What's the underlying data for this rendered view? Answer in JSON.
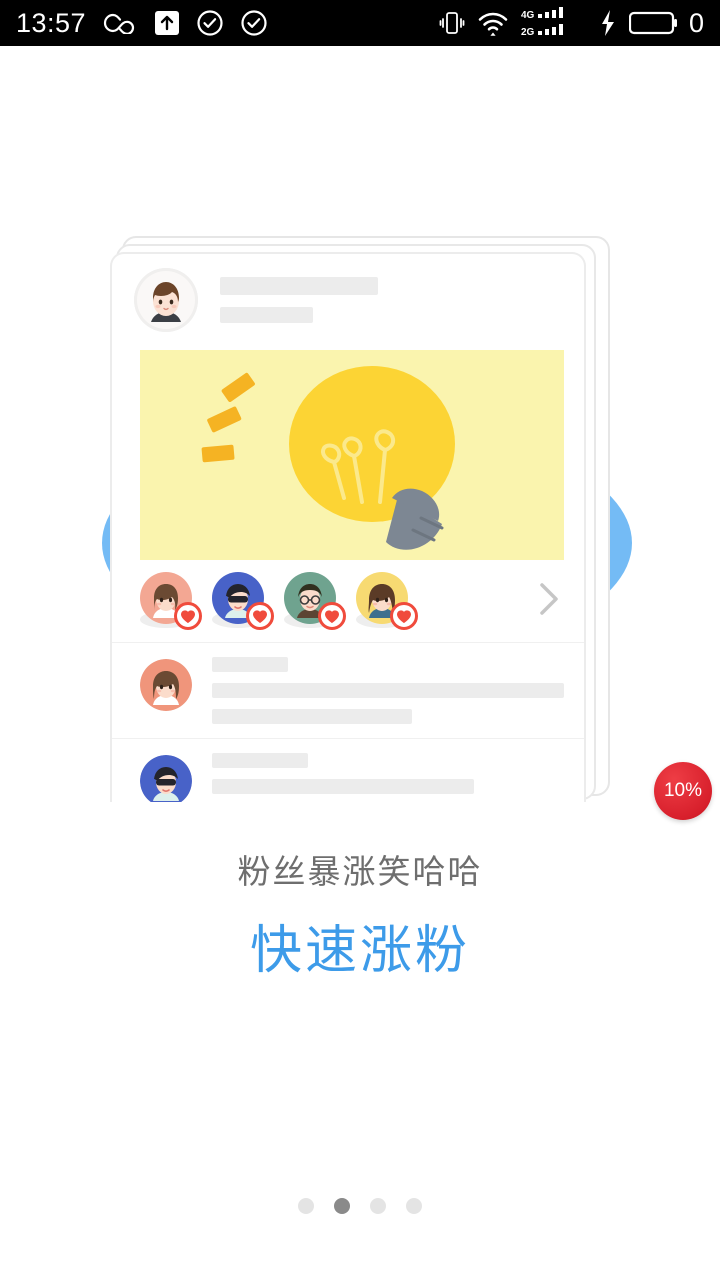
{
  "status_bar": {
    "time": "13:57",
    "battery_text": "0",
    "left_icons": [
      "infinity-icon",
      "upload-box-icon",
      "check-circle-icon",
      "check-circle-icon"
    ],
    "right_icons": [
      "vibrate-icon",
      "wifi-icon",
      "signal-4g-icon",
      "signal-2g-icon",
      "charging-bolt-icon",
      "battery-icon"
    ],
    "signal_labels": {
      "sim1": "4G",
      "sim2": "2G"
    },
    "background": "#000000",
    "foreground": "#ffffff"
  },
  "illustration": {
    "name": "social-post-card-stack",
    "blue_circle_color": "#74BBF5",
    "card_bg": "#ffffff",
    "photo_bg": "#FAF4AE",
    "bulb_color": "#FCD434",
    "bulb_base_color": "#7D8793",
    "ray_color": "#F5B323",
    "skeleton_color": "#ececec",
    "header_avatar": "boy-brown-hair-avatar",
    "like_avatars": [
      "girl-pink-bg-avatar",
      "man-sunglasses-blue-bg-avatar",
      "man-glasses-green-bg-avatar",
      "girl-yellow-bg-avatar"
    ],
    "heart_badge_color": "#F04B3C",
    "chevron": "chevron-right-icon",
    "comment_avatars": [
      "girl-orange-bg-avatar",
      "man-sunglasses-blue-bg-avatar"
    ]
  },
  "badge": {
    "label": "10%",
    "color": "#D8202C"
  },
  "caption": {
    "subtitle": "粉丝暴涨笑哈哈",
    "title": "快速涨粉",
    "subtitle_color": "#6e6e6e",
    "title_color": "#3D9BE9"
  },
  "pagination": {
    "total": 4,
    "active_index": 1,
    "active_color": "#8a8a8a",
    "inactive_color": "#e4e4e4"
  }
}
